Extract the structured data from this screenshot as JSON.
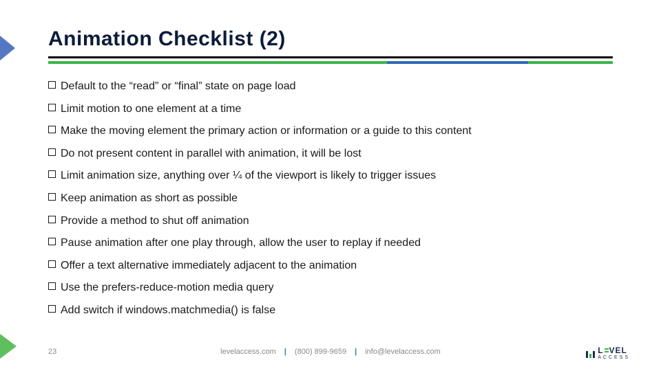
{
  "title": "Animation Checklist (2)",
  "items": [
    "Default to the “read” or “final” state on page load",
    "Limit motion to one element at a time",
    "Make the moving element the primary action or information or a guide to this content",
    "Do not present content in parallel with animation, it will be lost",
    "Limit animation size, anything over ¼ of the viewport is likely to trigger issues",
    "Keep animation as short as possible",
    "Provide a method to shut off animation",
    "Pause animation after one play through, allow the user to replay if needed",
    "Offer a text alternative immediately adjacent to the animation",
    "Use the prefers-reduce-motion media query",
    "Add switch if windows.matchmedia() is false"
  ],
  "footer": {
    "page": "23",
    "site": "levelaccess.com",
    "phone": "(800) 899-9659",
    "email": "info@levelaccess.com"
  },
  "logo": {
    "main_left": "L",
    "main_right": "VEL",
    "sub": "ACCESS"
  }
}
